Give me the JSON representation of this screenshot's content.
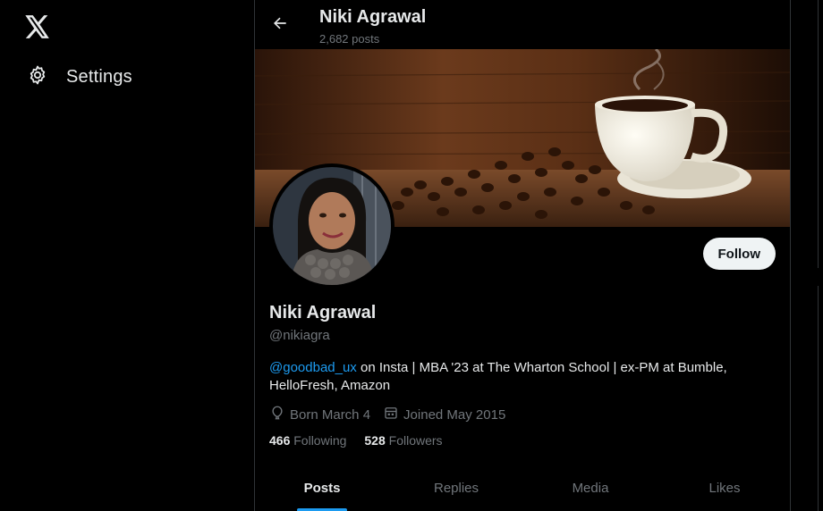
{
  "nav": {
    "logo_icon": "x-logo-icon",
    "settings_label": "Settings",
    "settings_icon": "gear-icon"
  },
  "header": {
    "name": "Niki Agrawal",
    "posts_count": "2,682 posts",
    "back_icon": "arrow-left-icon"
  },
  "profile": {
    "name": "Niki Agrawal",
    "handle": "@nikiagra",
    "follow_label": "Follow",
    "bio_mention": "@goodbad_ux",
    "bio_text": " on Insta | MBA '23 at The Wharton School | ex-PM at Bumble, HelloFresh, Amazon",
    "born": "Born March 4",
    "joined": "Joined May 2015",
    "following_count": "466",
    "following_label": "Following",
    "followers_count": "528",
    "followers_label": "Followers"
  },
  "tabs": [
    {
      "label": "Posts",
      "active": true
    },
    {
      "label": "Replies",
      "active": false
    },
    {
      "label": "Media",
      "active": false
    },
    {
      "label": "Likes",
      "active": false
    }
  ],
  "colors": {
    "accent": "#1d9bf0",
    "background": "#000000",
    "text_primary": "#e7e9ea",
    "text_secondary": "#71767b"
  }
}
